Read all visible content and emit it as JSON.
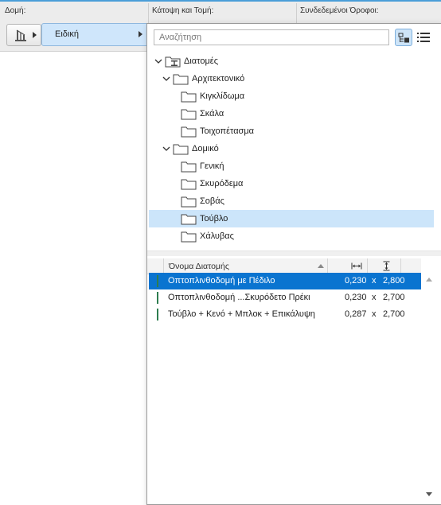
{
  "header": {
    "structure_label": "Δομή:",
    "floor_plan_label": "Κάτοψη και Τομή:",
    "linked_floors_label": "Συνδεδεμένοι Όροφοι:"
  },
  "structure_selector": {
    "icon": "building-structure-icon"
  },
  "category_selector": {
    "value": "Ειδική"
  },
  "popup": {
    "search": {
      "placeholder": "Αναζήτηση",
      "value": ""
    },
    "view_buttons": {
      "tree_icon": "tree-view-icon",
      "list_icon": "list-view-icon"
    },
    "tree": {
      "root": {
        "label": "Διατομές",
        "icon": "profile-section-icon"
      },
      "groups": [
        {
          "label": "Αρχιτεκτονικό",
          "items": [
            "Κιγκλίδωμα",
            "Σκάλα",
            "Τοιχοπέτασμα"
          ]
        },
        {
          "label": "Δομικό",
          "items": [
            "Γενική",
            "Σκυρόδεμα",
            "Σοβάς",
            "Τούβλο",
            "Χάλυβας"
          ]
        }
      ],
      "selected_item": "Τούβλο"
    },
    "list": {
      "columns": {
        "name": "Όνομα Διατομής",
        "width_icon": "width-dimension-icon",
        "height_icon": "height-dimension-icon"
      },
      "rows": [
        {
          "name": "Οπτοπλινθοδομή με Πέδιλο",
          "width": "0,230",
          "sep": "x",
          "height": "2,800",
          "selected": true
        },
        {
          "name": "Οπτοπλινθοδομή ...Σκυρόδετο Πρέκι",
          "width": "0,230",
          "sep": "x",
          "height": "2,700",
          "selected": false
        },
        {
          "name": "Τούβλο + Κενό + Μπλοκ + Επικάλυψη",
          "width": "0,287",
          "sep": "x",
          "height": "2,700",
          "selected": false
        }
      ]
    }
  },
  "colors": {
    "selection_blue": "#0a74d0",
    "tree_selection": "#cce5fa",
    "accent_strip": "#4a9ed8",
    "row_bar_green": "#2e7d4f"
  }
}
